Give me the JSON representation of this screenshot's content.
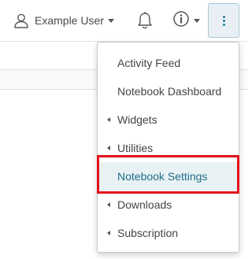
{
  "header": {
    "user_name": "Example User",
    "icons": {
      "user": "user-icon",
      "bell": "bell-icon",
      "info": "info-icon",
      "more": "vertical-ellipsis-icon"
    },
    "accent_color": "#1f7a9a"
  },
  "menu": {
    "items": [
      {
        "label": "Activity Feed",
        "submenu": false,
        "active": false
      },
      {
        "label": "Notebook Dashboard",
        "submenu": false,
        "active": false
      },
      {
        "label": "Widgets",
        "submenu": true,
        "active": false
      },
      {
        "label": "Utilities",
        "submenu": true,
        "active": false
      },
      {
        "label": "Notebook Settings",
        "submenu": false,
        "active": true
      },
      {
        "label": "Downloads",
        "submenu": true,
        "active": false
      },
      {
        "label": "Subscription",
        "submenu": true,
        "active": false
      }
    ],
    "highlight_color": "#e3111b"
  }
}
